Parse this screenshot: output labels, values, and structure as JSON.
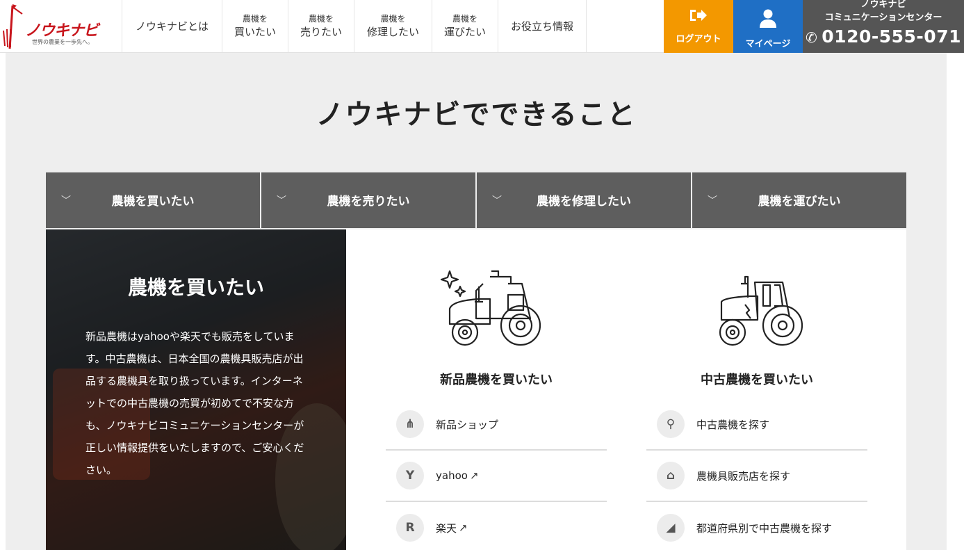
{
  "header": {
    "logo": {
      "name": "ノウキナビ",
      "tagline": "世界の農業を一歩先へ。"
    },
    "nav": [
      {
        "line1": "ノウキナビとは",
        "line2": ""
      },
      {
        "line1": "農機を",
        "line2": "買いたい"
      },
      {
        "line1": "農機を",
        "line2": "売りたい"
      },
      {
        "line1": "農機を",
        "line2": "修理したい"
      },
      {
        "line1": "農機を",
        "line2": "運びたい"
      },
      {
        "line1": "お役立ち情報",
        "line2": ""
      }
    ],
    "logout": {
      "label": "ログアウト",
      "icon": "logout-icon"
    },
    "mypage": {
      "label": "マイページ",
      "icon": "user-icon"
    },
    "center": {
      "line1": "ノウキナビ",
      "line2": "コミュニケーションセンター",
      "phone": "0120-555-071",
      "icon": "phone-icon"
    }
  },
  "section": {
    "title": "ノウキナビでできること",
    "tabs": [
      {
        "label": "農機を買いたい"
      },
      {
        "label": "農機を売りたい"
      },
      {
        "label": "農機を修理したい"
      },
      {
        "label": "農機を運びたい"
      }
    ],
    "panel": {
      "title": "農機を買いたい",
      "text": "新品農機はyahooや楽天でも販売をしています。中古農機は、日本全国の農機具販売店が出品する農機具を取り扱っています。インターネットでの中古農機の売買が初めてで不安な方も、ノウキナビコミュニケーションセンターが正しい情報提供をいたしますので、ご安心ください。",
      "columns": [
        {
          "title": "新品農機を買いたい",
          "icon": "new-tractor-icon",
          "links": [
            {
              "label": "新品ショップ",
              "icon": "nouki-logo-icon",
              "glyph": "⋔",
              "external": ""
            },
            {
              "label": "yahoo",
              "icon": "yahoo-icon",
              "glyph": "Y",
              "external": "↗"
            },
            {
              "label": "楽天",
              "icon": "rakuten-icon",
              "glyph": "R",
              "external": "↗"
            }
          ]
        },
        {
          "title": "中古農機を買いたい",
          "icon": "used-tractor-icon",
          "links": [
            {
              "label": "中古農機を探す",
              "icon": "search-icon",
              "glyph": "⚲",
              "external": ""
            },
            {
              "label": "農機具販売店を探す",
              "icon": "store-icon",
              "glyph": "⌂",
              "external": ""
            },
            {
              "label": "都道府県別で中古農機を探す",
              "icon": "map-icon",
              "glyph": "◢",
              "external": ""
            }
          ]
        }
      ]
    }
  },
  "colors": {
    "brand_red": "#c8161d",
    "logout_orange": "#f39800",
    "mypage_blue": "#1f6fc5",
    "center_gray": "#555555",
    "tab_gray": "#5e5e5e",
    "section_bg": "#eeeeee"
  }
}
